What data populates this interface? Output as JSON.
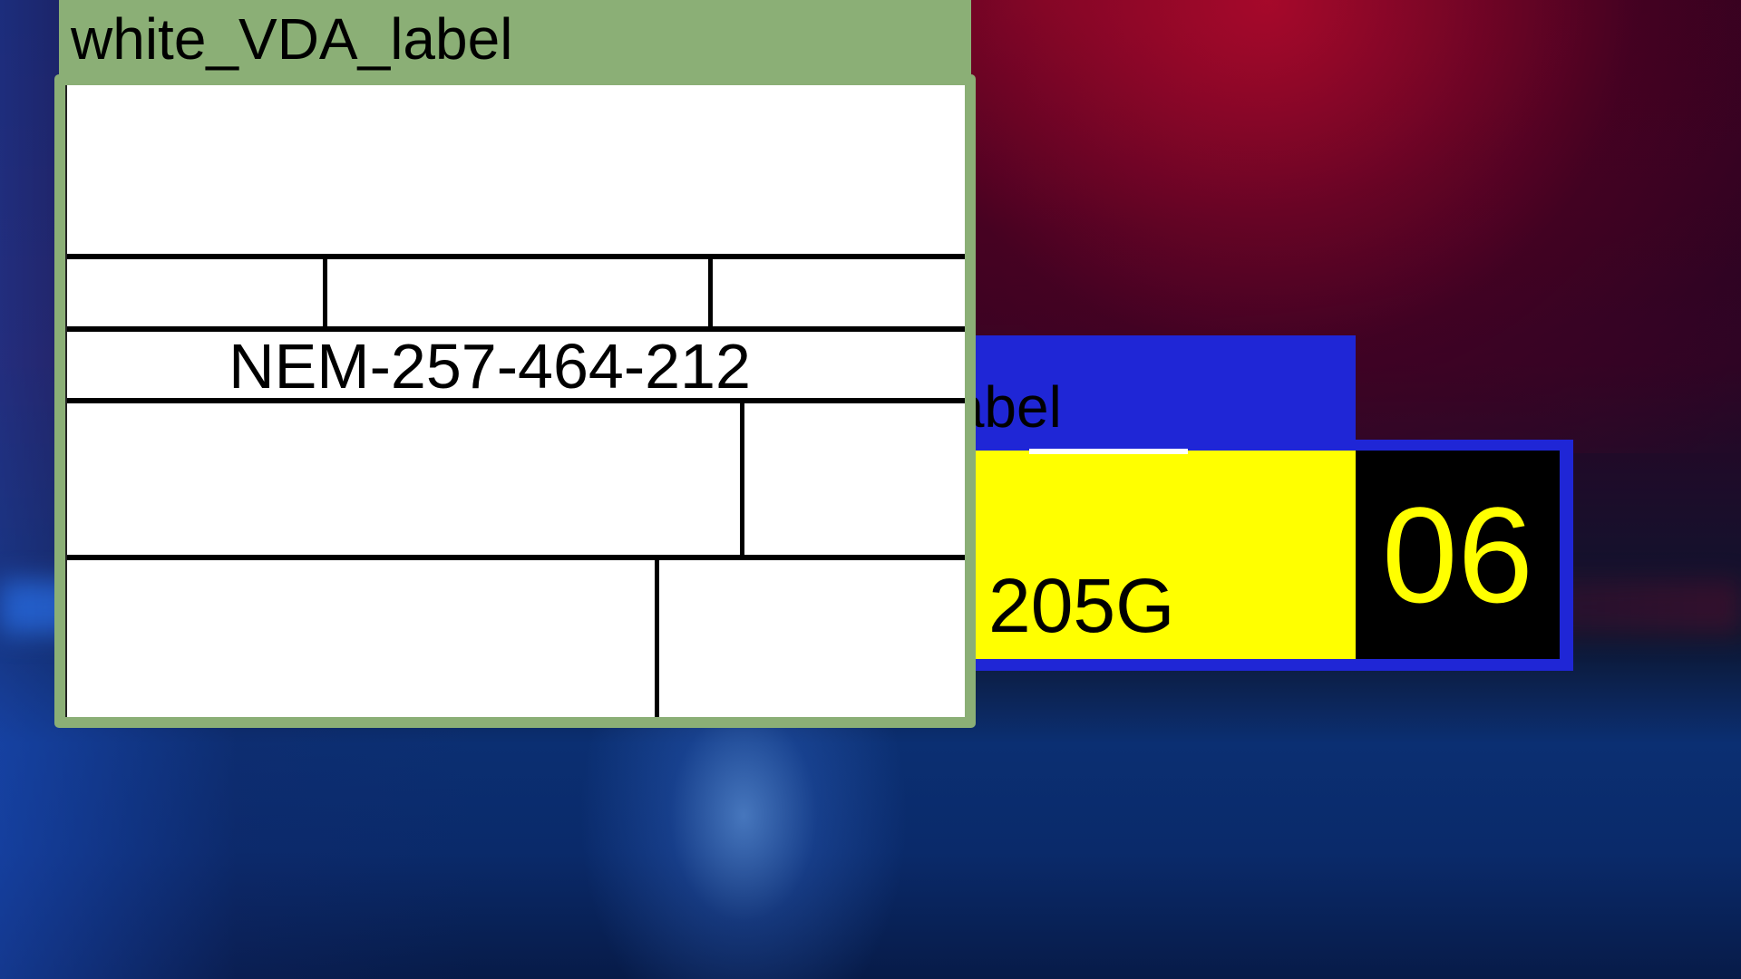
{
  "windows": {
    "white_label": {
      "title": "white_VDA_label",
      "serial": "NEM-257-464-212",
      "frame_color": "#8baf76"
    },
    "yellow_label": {
      "title_visible": "_label",
      "code": "205G",
      "number": "06",
      "frame_color": "#1f26d6",
      "panel_color": "#ffff00"
    }
  }
}
